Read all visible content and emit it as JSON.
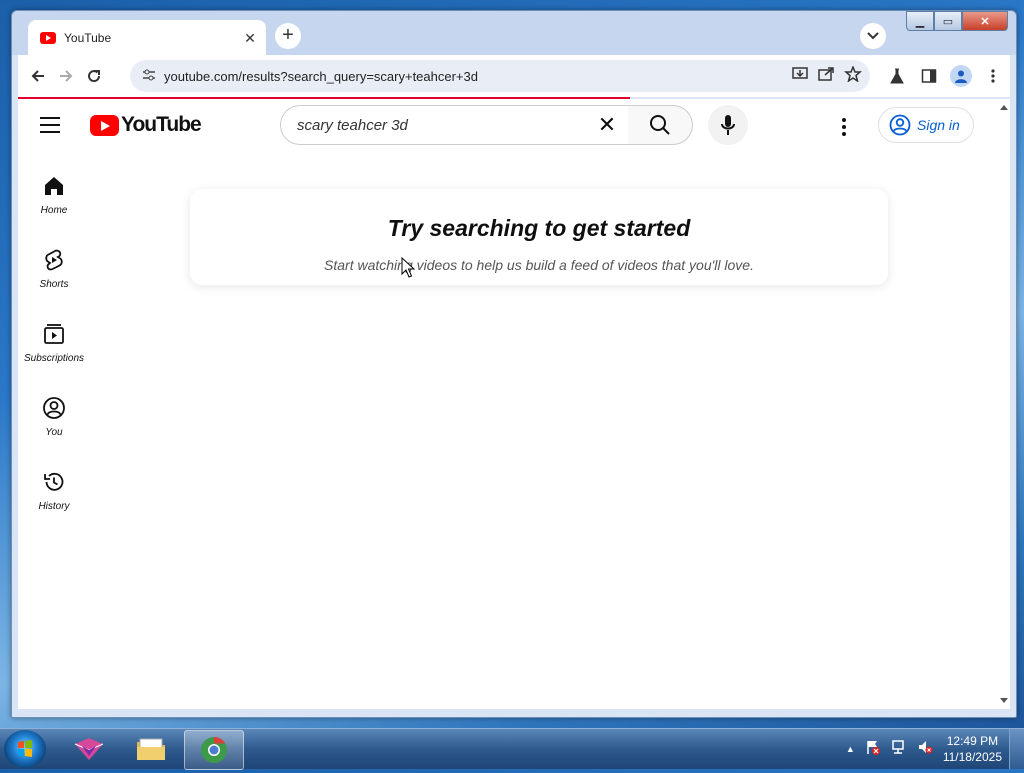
{
  "browser": {
    "tab": {
      "title": "YouTube",
      "close_icon": "close-icon"
    },
    "url": "youtube.com/results?search_query=scary+teahcer+3d"
  },
  "youtube": {
    "logo_text": "YouTube",
    "search_query": "scary teahcer 3d",
    "sign_in_label": "Sign in",
    "sidebar": [
      {
        "label": "Home",
        "icon": "home-icon"
      },
      {
        "label": "Shorts",
        "icon": "shorts-icon"
      },
      {
        "label": "Subscriptions",
        "icon": "subscriptions-icon"
      },
      {
        "label": "You",
        "icon": "you-icon"
      },
      {
        "label": "History",
        "icon": "history-icon"
      }
    ],
    "empty_state": {
      "heading": "Try searching to get started",
      "subtext": "Start watching videos to help us build a feed of videos that you'll love."
    }
  },
  "taskbar": {
    "time": "12:49 PM",
    "date": "11/18/2025"
  },
  "colors": {
    "youtube_red": "#ff0000",
    "link_blue": "#065fd4",
    "load_bar": "#e1002d"
  }
}
